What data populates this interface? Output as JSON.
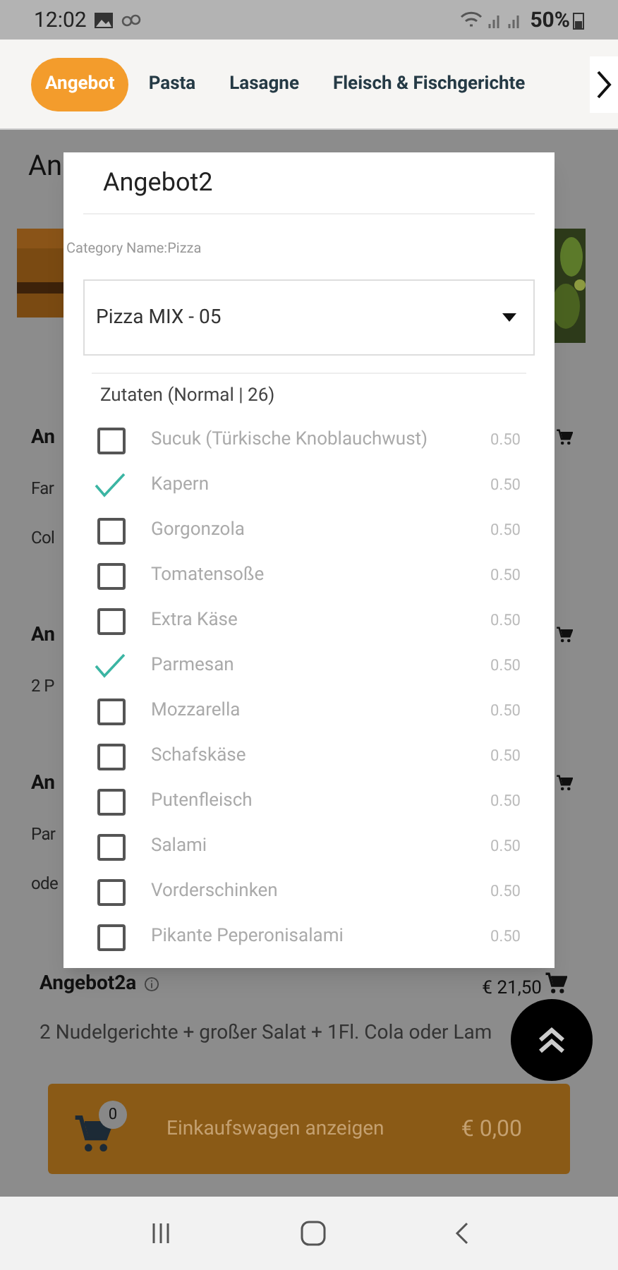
{
  "status_bar": {
    "time": "12:02",
    "battery": "50%"
  },
  "tabs": [
    {
      "label": "Angebot",
      "selected": true
    },
    {
      "label": "Pasta",
      "selected": false
    },
    {
      "label": "Lasagne",
      "selected": false
    },
    {
      "label": "Fleisch & Fischgerichte",
      "selected": false
    }
  ],
  "page_title": "An",
  "background_items": [
    {
      "title": "An",
      "lines": [
        "Far",
        "Col"
      ]
    },
    {
      "title": "An",
      "lines": [
        "2 P"
      ]
    },
    {
      "title": "An",
      "lines": [
        "Par",
        "ode"
      ]
    }
  ],
  "offer": {
    "title": "Angebot2a",
    "price": "€ 21,50",
    "description": "2 Nudelgerichte + großer Salat + 1Fl. Cola oder Lam"
  },
  "cart_bar": {
    "count": "0",
    "label": "Einkaufswagen anzeigen",
    "total": "€ 0,00"
  },
  "dialog": {
    "title": "Angebot2",
    "category": "Category Name:Pizza",
    "select_value": "Pizza MIX - 05",
    "section": "Zutaten (Normal | 26)",
    "ingredients": [
      {
        "name": "Sucuk (Türkische Knoblauchwust)",
        "price": "0.50",
        "checked": false
      },
      {
        "name": "Kapern",
        "price": "0.50",
        "checked": true
      },
      {
        "name": "Gorgonzola",
        "price": "0.50",
        "checked": false
      },
      {
        "name": "Tomatensoße",
        "price": "0.50",
        "checked": false
      },
      {
        "name": "Extra Käse",
        "price": "0.50",
        "checked": false
      },
      {
        "name": "Parmesan",
        "price": "0.50",
        "checked": true
      },
      {
        "name": "Mozzarella",
        "price": "0.50",
        "checked": false
      },
      {
        "name": "Schafskäse",
        "price": "0.50",
        "checked": false
      },
      {
        "name": "Putenfleisch",
        "price": "0.50",
        "checked": false
      },
      {
        "name": "Salami",
        "price": "0.50",
        "checked": false
      },
      {
        "name": "Vorderschinken",
        "price": "0.50",
        "checked": false
      },
      {
        "name": "Pikante Peperonisalami",
        "price": "0.50",
        "checked": false
      }
    ]
  }
}
